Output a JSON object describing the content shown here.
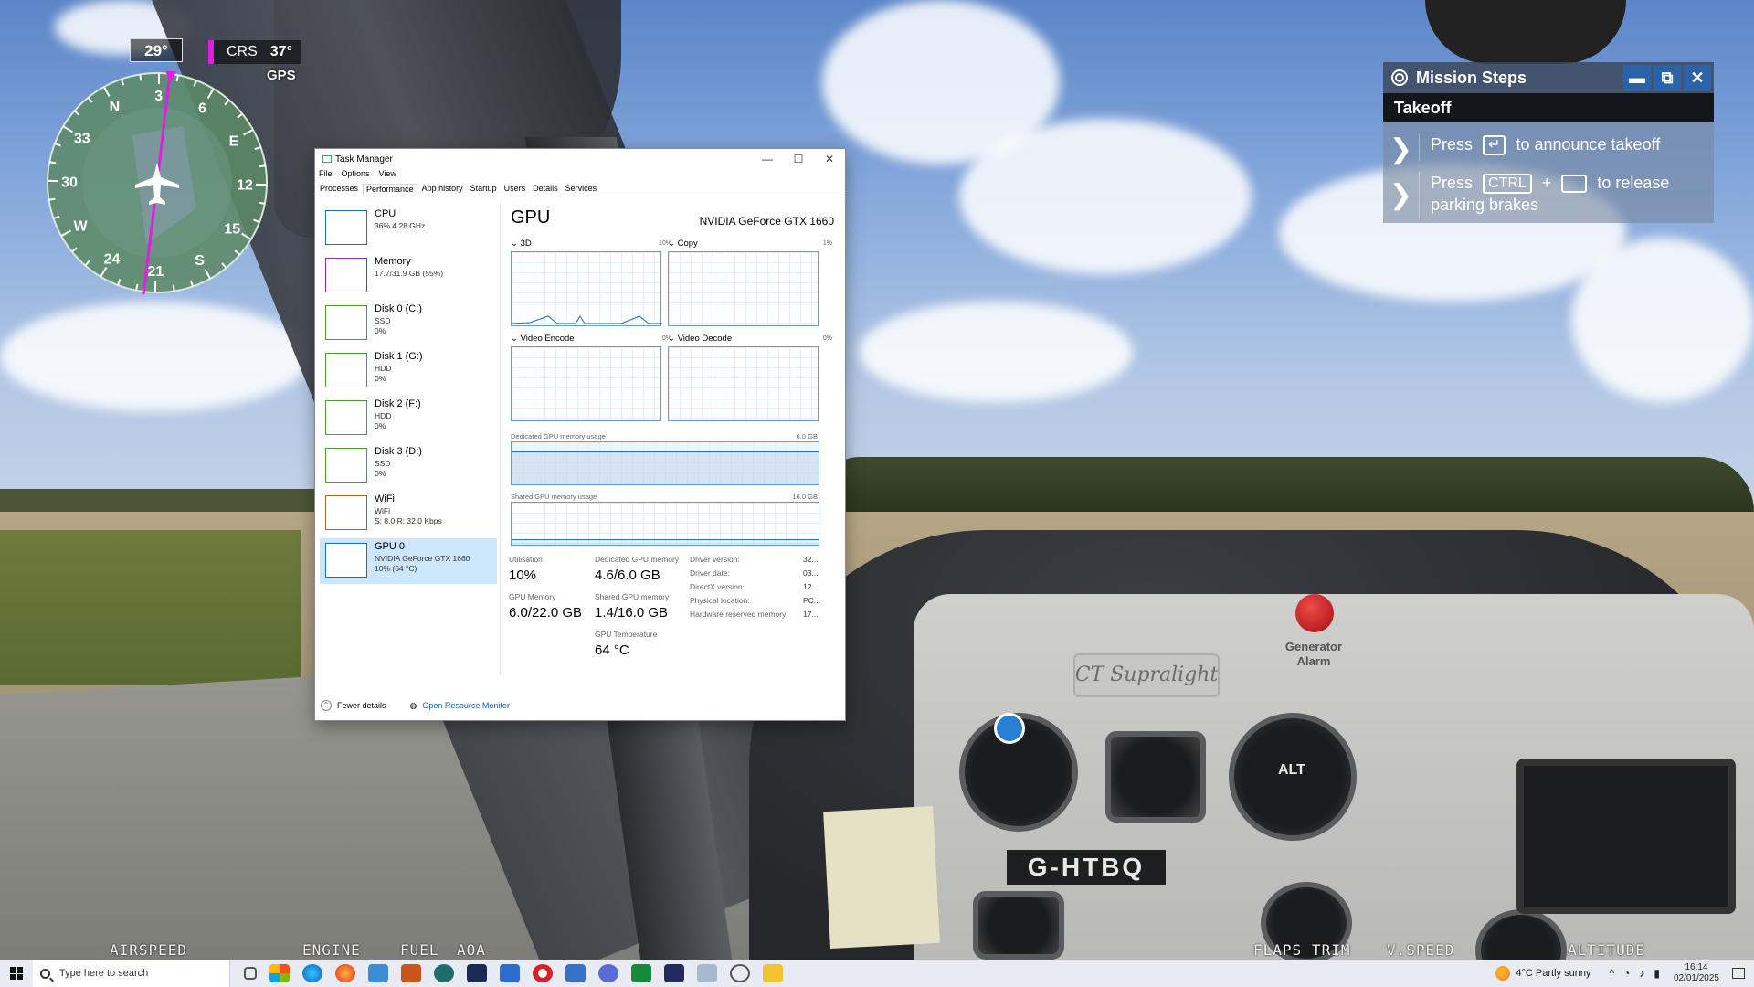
{
  "hud": {
    "heading": "29°",
    "crs_label": "CRS",
    "crs_value": "37°",
    "nav_source": "GPS",
    "compass_cardinals": [
      "N",
      "E",
      "S",
      "W"
    ],
    "compass_numbers": [
      "3",
      "6",
      "12",
      "15",
      "21",
      "24",
      "30",
      "33"
    ],
    "bottom_labels": [
      "AIRSPEED",
      "ENGINE",
      "FUEL",
      "AOA",
      "FLAPS",
      "TRIM",
      "V.SPEED",
      "ALTITUDE"
    ],
    "accent_color": "#e01ee0"
  },
  "mission": {
    "title": "Mission Steps",
    "stage": "Takeoff",
    "steps": [
      {
        "pre": "Press",
        "key": "↵",
        "post": "to announce takeoff"
      },
      {
        "pre": "Press",
        "key": "CTRL",
        "plus": "+",
        "key2": "",
        "post": "to release",
        "post2": "parking brakes"
      }
    ],
    "buttons": [
      "minimize-icon",
      "popout-icon",
      "close-icon"
    ]
  },
  "cockpit": {
    "registration": "G-HTBQ",
    "brand": "CT Supralight",
    "alarm_label_1": "Generator",
    "alarm_label_2": "Alarm",
    "alt_label": "ALT"
  },
  "taskmanager": {
    "title": "Task Manager",
    "menu": [
      "File",
      "Options",
      "View"
    ],
    "tabs": [
      "Processes",
      "Performance",
      "App history",
      "Startup",
      "Users",
      "Details",
      "Services"
    ],
    "active_tab": "Performance",
    "resources": [
      {
        "name": "CPU",
        "sub1": "36% 4.28 GHz",
        "sub2": "",
        "color": "#1e6fb9"
      },
      {
        "name": "Memory",
        "sub1": "17.7/31.9 GB (55%)",
        "sub2": "",
        "color": "#8b2ea0"
      },
      {
        "name": "Disk 0 (C:)",
        "sub1": "SSD",
        "sub2": "0%",
        "color": "#4c9a2a"
      },
      {
        "name": "Disk 1 (G:)",
        "sub1": "HDD",
        "sub2": "0%",
        "color": "#4c9a2a"
      },
      {
        "name": "Disk 2 (F:)",
        "sub1": "HDD",
        "sub2": "0%",
        "color": "#4c9a2a"
      },
      {
        "name": "Disk 3 (D:)",
        "sub1": "SSD",
        "sub2": "0%",
        "color": "#4c9a2a"
      },
      {
        "name": "WiFi",
        "sub1": "WiFi",
        "sub2": "S: 8.0  R: 32.0 Kbps",
        "color": "#a7652a"
      },
      {
        "name": "GPU 0",
        "sub1": "NVIDIA GeForce GTX 1660",
        "sub2": "10% (64 °C)",
        "color": "#1e6fb9"
      }
    ],
    "gpu": {
      "title": "GPU",
      "model": "NVIDIA GeForce GTX 1660",
      "engines": [
        {
          "label": "3D",
          "pct": "10%"
        },
        {
          "label": "Copy",
          "pct": "1%"
        },
        {
          "label": "Video Encode",
          "pct": "0%"
        },
        {
          "label": "Video Decode",
          "pct": "0%"
        }
      ],
      "dedicated_label": "Dedicated GPU memory usage",
      "dedicated_max": "6.0 GB",
      "shared_label": "Shared GPU memory usage",
      "shared_max": "16.0 GB",
      "stats": [
        {
          "label": "Utilisation",
          "value": "10%"
        },
        {
          "label": "Dedicated GPU memory",
          "value": "4.6/6.0 GB"
        },
        {
          "label": "GPU Memory",
          "value": "6.0/22.0 GB"
        },
        {
          "label": "Shared GPU memory",
          "value": "1.4/16.0 GB"
        },
        {
          "label": "GPU Temperature",
          "value": "64 °C"
        }
      ],
      "driver": [
        {
          "label": "Driver version:",
          "value": "32..."
        },
        {
          "label": "Driver date:",
          "value": "03..."
        },
        {
          "label": "DirectX version:",
          "value": "12..."
        },
        {
          "label": "Physical location:",
          "value": "PC..."
        },
        {
          "label": "Hardware reserved memory:",
          "value": "17..."
        }
      ]
    },
    "footer": {
      "fewer": "Fewer details",
      "monitor": "Open Resource Monitor"
    }
  },
  "taskbar": {
    "search_placeholder": "Type here to search",
    "weather": "4°C  Partly sunny",
    "time": "16:14",
    "date": "02/01/2025"
  }
}
